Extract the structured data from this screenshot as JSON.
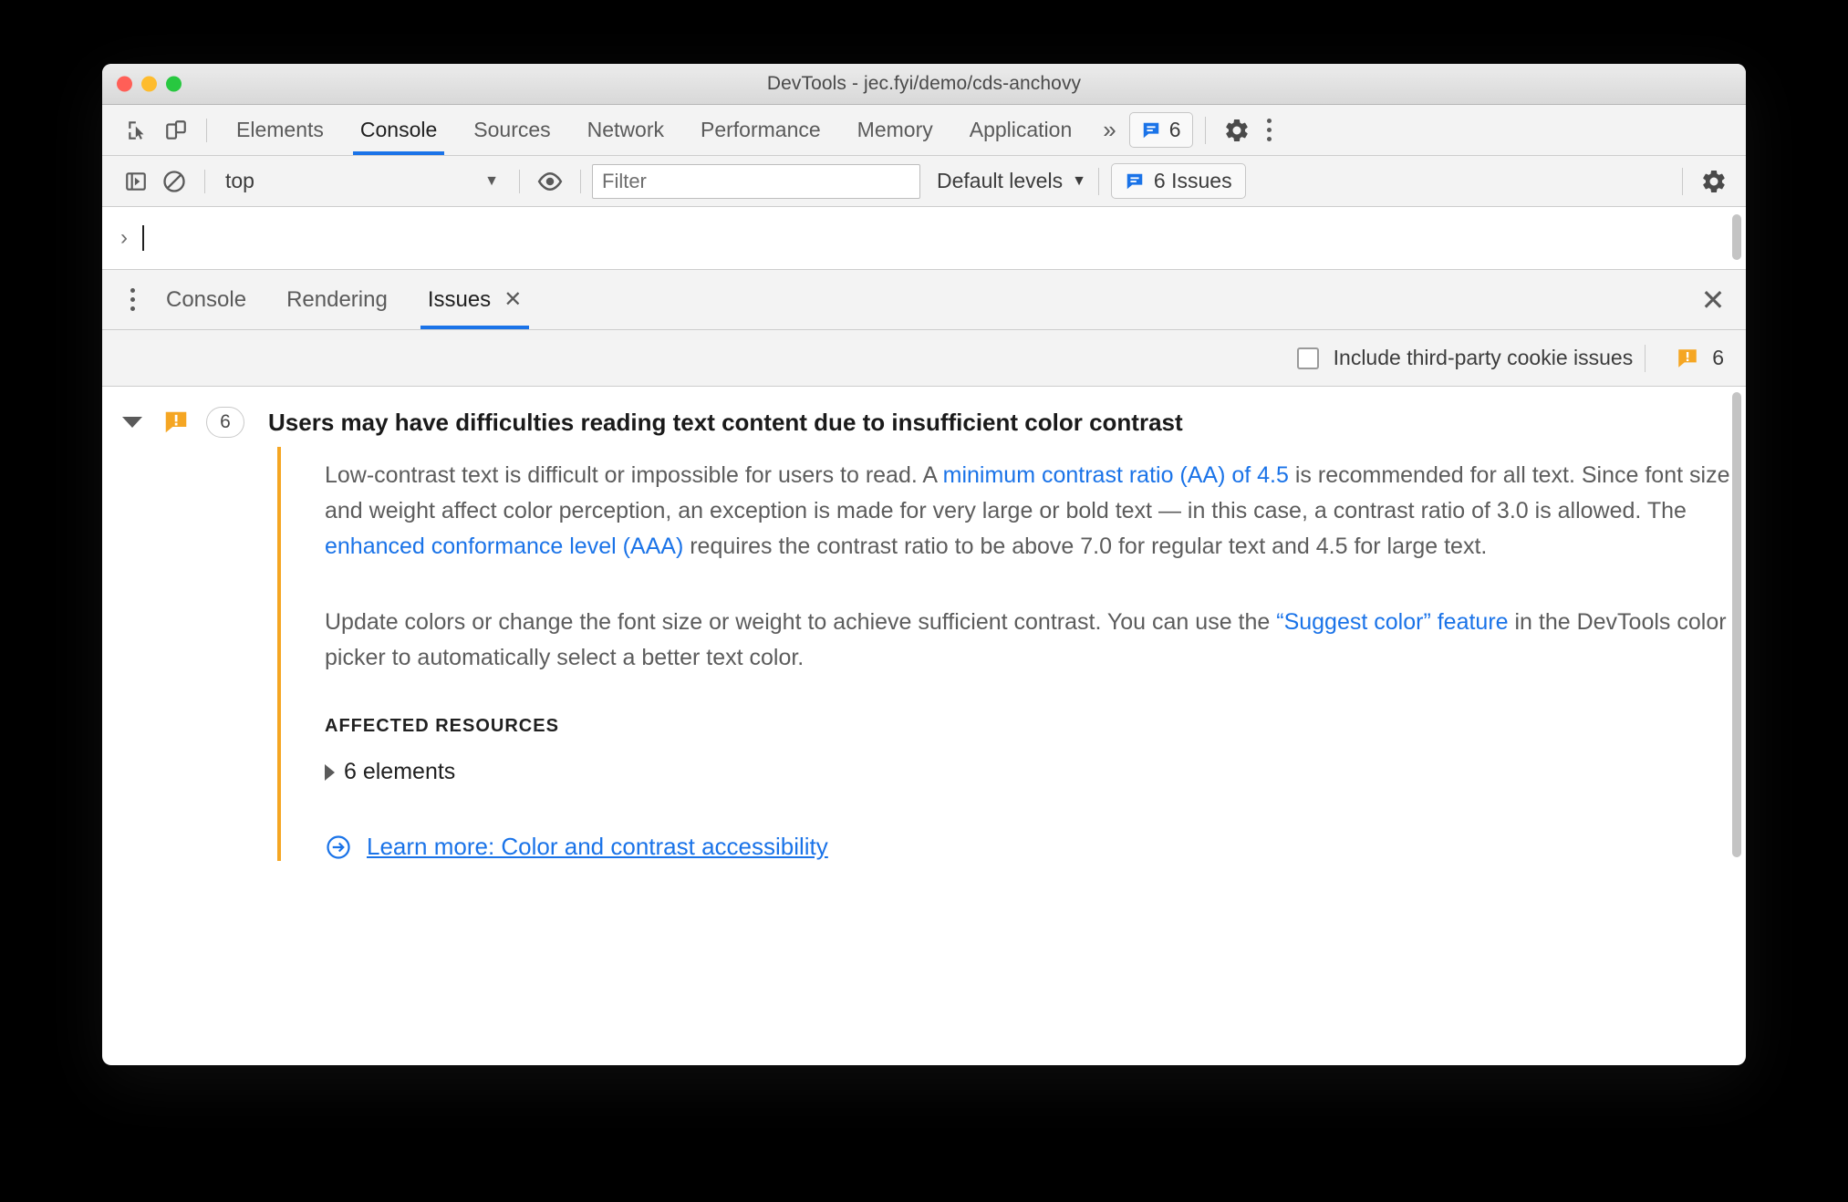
{
  "window": {
    "title": "DevTools - jec.fyi/demo/cds-anchovy",
    "traffic_lights": [
      "close",
      "minimize",
      "zoom"
    ]
  },
  "panel_tabbar": {
    "inspect_icon": "inspect-cursor-icon",
    "device_icon": "device-toolbar-icon",
    "tabs": [
      {
        "label": "Elements",
        "selected": false
      },
      {
        "label": "Console",
        "selected": true
      },
      {
        "label": "Sources",
        "selected": false
      },
      {
        "label": "Network",
        "selected": false
      },
      {
        "label": "Performance",
        "selected": false
      },
      {
        "label": "Memory",
        "selected": false
      },
      {
        "label": "Application",
        "selected": false
      }
    ],
    "more_tabs": "»",
    "issues_pill": {
      "icon": "issues-blue-icon",
      "count": "6"
    },
    "settings_icon": "gear-icon",
    "kebab_icon": "more-options-icon"
  },
  "console_toolbar": {
    "sidebar_icon": "console-sidebar-icon",
    "clear_icon": "clear-console-icon",
    "context": "top",
    "context_caret": "▼",
    "eye_icon": "live-expression-icon",
    "filter_placeholder": "Filter",
    "filter_value": "",
    "levels_label": "Default levels",
    "levels_caret": "▼",
    "issues_button": {
      "icon": "issues-blue-icon",
      "label": "6 Issues"
    },
    "settings_icon": "gear-icon"
  },
  "console_prompt": {
    "arrow": "›",
    "value": ""
  },
  "drawer": {
    "kebab_icon": "drawer-more-options-icon",
    "tabs": [
      {
        "label": "Console",
        "selected": false,
        "closable": false
      },
      {
        "label": "Rendering",
        "selected": false,
        "closable": false
      },
      {
        "label": "Issues",
        "selected": true,
        "closable": true,
        "close_glyph": "✕"
      }
    ],
    "close_glyph": "✕"
  },
  "issues_filterbar": {
    "checkbox_label": "Include third-party cookie issues",
    "checkbox_checked": false,
    "warning_icon": "issue-warning-orange-icon",
    "count": "6"
  },
  "issue": {
    "expanded": true,
    "icon": "issue-warning-orange-icon",
    "count": "6",
    "title": "Users may have difficulties reading text content due to insufficient color contrast",
    "paragraph1": {
      "part1": "Low-contrast text is difficult or impossible for users to read. A ",
      "link1": "minimum contrast ratio (AA) of 4.5",
      "part2": " is recommended for all text. Since font size and weight affect color perception, an exception is made for very large or bold text — in this case, a contrast ratio of 3.0 is allowed. The ",
      "link2": "enhanced conformance level (AAA)",
      "part3": " requires the contrast ratio to be above 7.0 for regular text and 4.5 for large text."
    },
    "paragraph2": {
      "part1": "Update colors or change the font size or weight to achieve sufficient contrast. You can use the ",
      "link1": "“Suggest color” feature",
      "part2": " in the DevTools color picker to automatically select a better text color."
    },
    "affected_resources_heading": "AFFECTED RESOURCES",
    "affected_resource_item": "6 elements",
    "learn_more": {
      "icon": "external-arrow-circle-icon",
      "label": "Learn more: Color and contrast accessibility"
    }
  },
  "colors": {
    "accent_blue": "#1a73e8",
    "warning_orange": "#f5a623",
    "toolbar_bg": "#f3f3f3",
    "text_primary": "#202020",
    "text_secondary": "#5c5c5c"
  }
}
